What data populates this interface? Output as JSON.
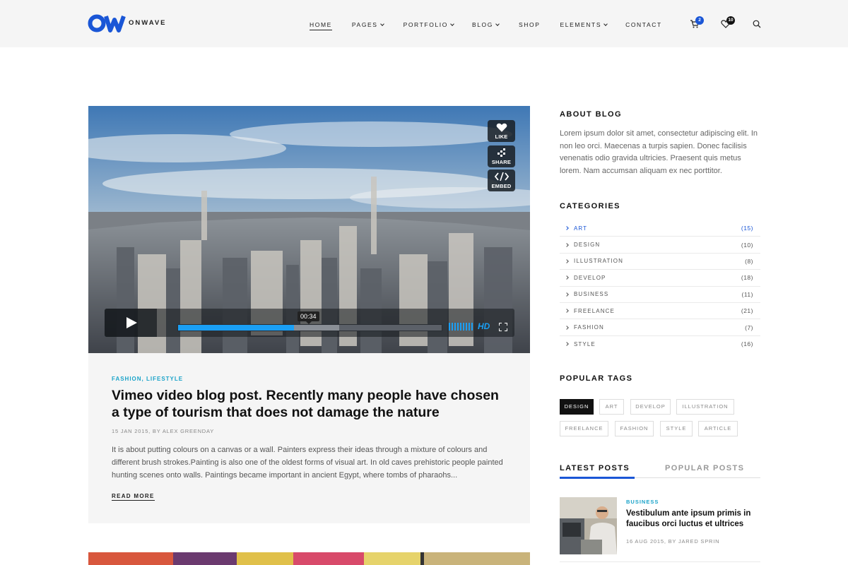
{
  "brand": {
    "name": "ONWAVE",
    "accent": "#1a56d6"
  },
  "nav": {
    "items": [
      {
        "label": "HOME",
        "active": true,
        "dropdown": false
      },
      {
        "label": "PAGES",
        "active": false,
        "dropdown": true
      },
      {
        "label": "PORTFOLIO",
        "active": false,
        "dropdown": true
      },
      {
        "label": "BLOG",
        "active": false,
        "dropdown": true
      },
      {
        "label": "SHOP",
        "active": false,
        "dropdown": false
      },
      {
        "label": "ELEMENTS",
        "active": false,
        "dropdown": true
      },
      {
        "label": "CONTACT",
        "active": false,
        "dropdown": false
      }
    ],
    "cart_count": "2",
    "wishlist_count": "10"
  },
  "video": {
    "buttons": {
      "like": "LIKE",
      "share": "SHARE",
      "embed": "EMBED"
    },
    "timecode": "00:34",
    "progress": 0.44,
    "buffered": 0.61,
    "hd_label": "HD"
  },
  "post": {
    "categories": "FASHION, LIFESTYLE",
    "title": "Vimeo video blog post. Recently many people have chosen a type of tourism that does not damage the nature",
    "meta": "15 JAN 2015, BY ALEX GREENDAY",
    "excerpt": "It is about putting colours on a canvas or a wall. Painters express their ideas through a mixture of colours and different brush strokes.Painting is also one of the oldest forms of visual art. In old caves prehistoric people painted hunting scenes onto walls. Paintings became important in ancient Egypt, where tombs of pharaohs...",
    "read_more": "READ MORE"
  },
  "sidebar": {
    "about": {
      "heading": "ABOUT BLOG",
      "text": "Lorem ipsum dolor sit amet, consectetur adipiscing elit. In non leo orci. Maecenas a turpis sapien. Donec facilisis venenatis odio gravida ultricies. Praesent quis metus lorem. Nam accumsan aliquam ex nec porttitor."
    },
    "categories": {
      "heading": "CATEGORIES",
      "items": [
        {
          "label": "ART",
          "count": "(15)",
          "active": true
        },
        {
          "label": "DESIGN",
          "count": "(10)",
          "active": false
        },
        {
          "label": "ILLUSTRATION",
          "count": "(8)",
          "active": false
        },
        {
          "label": "DEVELOP",
          "count": "(18)",
          "active": false
        },
        {
          "label": "BUSINESS",
          "count": "(11)",
          "active": false
        },
        {
          "label": "FREELANCE",
          "count": "(21)",
          "active": false
        },
        {
          "label": "FASHION",
          "count": "(7)",
          "active": false
        },
        {
          "label": "STYLE",
          "count": "(16)",
          "active": false
        }
      ]
    },
    "tags": {
      "heading": "POPULAR TAGS",
      "items": [
        {
          "label": "DESIGN",
          "active": true
        },
        {
          "label": "ART",
          "active": false
        },
        {
          "label": "DEVELOP",
          "active": false
        },
        {
          "label": "ILLUSTRATION",
          "active": false
        },
        {
          "label": "FREELANCE",
          "active": false
        },
        {
          "label": "FASHION",
          "active": false
        },
        {
          "label": "STYLE",
          "active": false
        },
        {
          "label": "ARTICLE",
          "active": false
        }
      ]
    },
    "posts_tabs": {
      "latest": "LATEST POSTS",
      "popular": "POPULAR POSTS"
    },
    "latest_post": {
      "category": "BUSINESS",
      "title": "Vestibulum ante ipsum primis in faucibus orci luctus et ultrices",
      "meta": "16 AUG 2015, BY JARED SPRIN"
    }
  }
}
